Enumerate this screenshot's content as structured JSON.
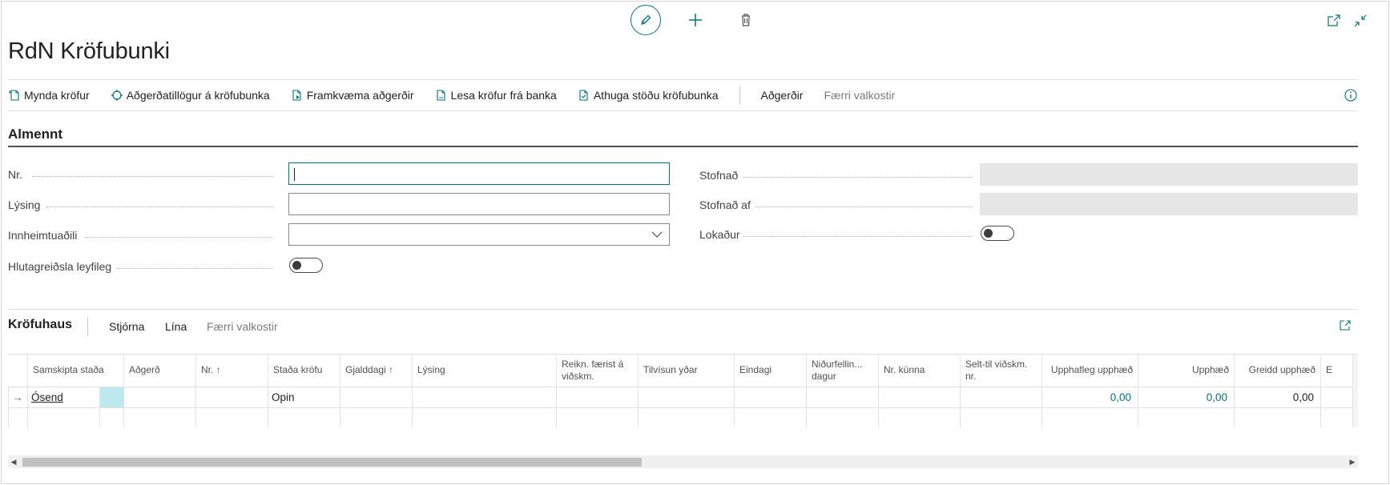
{
  "window": {
    "title": "RdN Kröfubunki",
    "icons": [
      "edit-icon",
      "plus-icon",
      "trash-icon",
      "popout-icon",
      "collapse-icon",
      "info-icon"
    ]
  },
  "action_bar": {
    "items": [
      {
        "label": "Mynda kröfur",
        "icon": "new-doc-icon"
      },
      {
        "label": "Aðgerðatillögur á kröfubunka",
        "icon": "suggest-icon"
      },
      {
        "label": "Framkvæma aðgerðir",
        "icon": "execute-icon"
      },
      {
        "label": "Lesa kröfur frá banka",
        "icon": "read-doc-icon"
      },
      {
        "label": "Athuga stöðu kröfubunka",
        "icon": "check-doc-icon"
      }
    ],
    "more_label": "Aðgerðir",
    "fewer_label": "Færri valkostir"
  },
  "general": {
    "title": "Almennt",
    "left_fields": [
      {
        "label": "Nr.",
        "value": ""
      },
      {
        "label": "Lýsing",
        "value": ""
      },
      {
        "label": "Innheimtuaðili",
        "value": ""
      },
      {
        "label": "Hlutagreiðsla leyfileg",
        "value": false
      }
    ],
    "right_fields": [
      {
        "label": "Stofnað",
        "value": ""
      },
      {
        "label": "Stofnað af",
        "value": ""
      },
      {
        "label": "Lokaður",
        "value": false
      }
    ]
  },
  "subpage": {
    "title": "Kröfuhaus",
    "actions": [
      "Stjórna",
      "Lína",
      "Færri valkostir"
    ],
    "columns": [
      "Samskipta staða",
      "Aðgerð",
      "Nr. ↑",
      "Staða kröfu",
      "Gjalddagi ↑",
      "Lýsing",
      "Reikn. færist á viðskm.",
      "Tilvísun yðar",
      "Eindagi",
      "Niðurfellin... dagur",
      "Nr. kúnna",
      "Selt-til viðskm. nr.",
      "Upphafleg upphæð",
      "Upphæð",
      "Greidd upphæð",
      "E"
    ],
    "rows": [
      {
        "marker": "→",
        "status": "Ósend",
        "action": "",
        "no": "",
        "claim_status": "Opin",
        "due_date": "",
        "description": "",
        "bill_to": "",
        "your_reference": "",
        "final_due": "",
        "cancel_date": "",
        "customer_no": "",
        "sell_to": "",
        "original_amount": "0,00",
        "amount": "0,00",
        "paid_amount": "0,00"
      }
    ]
  },
  "colors": {
    "accent": "#00757a",
    "selected_cell": "#bde8ee",
    "readonly_field": "#e6e6e6"
  }
}
